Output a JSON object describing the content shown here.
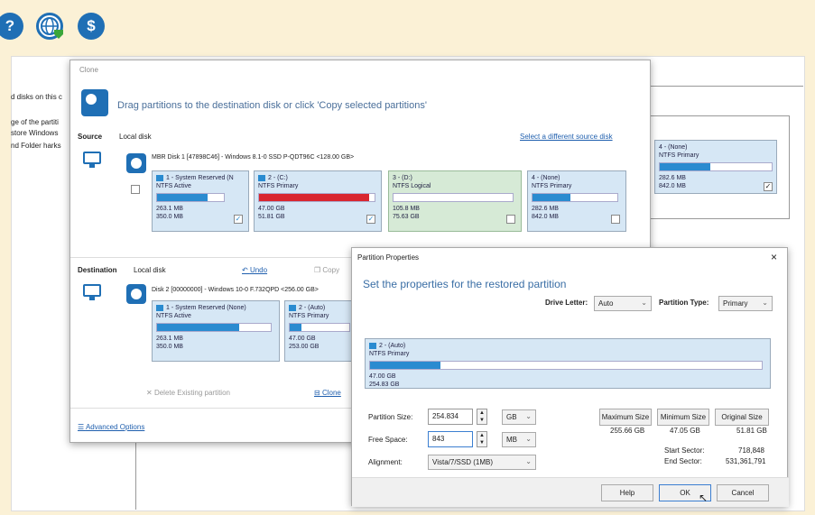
{
  "toolbar": {
    "icon1": "?",
    "icon3": "$"
  },
  "bg": {
    "line1": "d disks on this c",
    "line2": "ge of the partiti",
    "line3": "store Windows",
    "line4": "nd Folder harks",
    "panel_part": {
      "title": "4 - (None)",
      "type": "NTFS Primary",
      "size1": "282.6 MB",
      "size2": "842.0 MB",
      "bar": 0.45
    }
  },
  "clone": {
    "title": "Clone",
    "header": "Drag partitions to the destination disk or click 'Copy selected partitions'",
    "source_label": "Source",
    "source_type": "Local disk",
    "select_source_link": "Select a different source disk",
    "source_disk_info": "MBR Disk 1 [47898C46] - Windows 8.1-0 SSD P-QDT96C <128.00 GB>",
    "source_partitions": [
      {
        "title": "1 - System Reserved (N",
        "type": "NTFS Active",
        "s1": "263.1 MB",
        "s2": "350.0 MB",
        "fill": 0.75,
        "color": "blue",
        "checked": true
      },
      {
        "title": "2 - (C:)",
        "type": "NTFS Primary",
        "s1": "47.00 GB",
        "s2": "51.81 GB",
        "fill": 0.95,
        "color": "red",
        "checked": true
      },
      {
        "title": "3 - (D:)",
        "type": "NTFS Logical",
        "s1": "105.8 MB",
        "s2": "75.63 GB",
        "fill": 0.0,
        "color": "blue",
        "checked": false
      },
      {
        "title": "4 - (None)",
        "type": "NTFS Primary",
        "s1": "282.6 MB",
        "s2": "842.0 MB",
        "fill": 0.45,
        "color": "blue",
        "checked": false
      }
    ],
    "dest_label": "Destination",
    "dest_type": "Local disk",
    "undo": "Undo",
    "copy": "Copy",
    "dest_disk_info": "Disk 2 [00000000] - Windows 10-0 F.732QPD <256.00 GB>",
    "dest_partitions": [
      {
        "title": "1 - System Reserved (None)",
        "type": "NTFS Active",
        "s1": "263.1 MB",
        "s2": "350.0 MB",
        "fill": 0.72
      },
      {
        "title": "2 - (Auto)",
        "type": "NTFS Primary",
        "s1": "47.00 GB",
        "s2": "253.00 GB",
        "fill": 0.2
      }
    ],
    "delete_existing": "Delete Existing partition",
    "clone_link": "Clone",
    "advanced_options": "Advanced Options"
  },
  "props": {
    "title": "Partition Properties",
    "close": "×",
    "heading": "Set the properties for the restored partition",
    "drive_letter_label": "Drive Letter:",
    "drive_letter_value": "Auto",
    "partition_type_label": "Partition Type:",
    "partition_type_value": "Primary",
    "part_title": "2 - (Auto)",
    "part_type": "NTFS Primary",
    "part_s1": "47.00 GB",
    "part_s2": "254.83 GB",
    "part_fill": 0.18,
    "size_label": "Partition Size:",
    "size_value": "254.834",
    "size_unit": "GB",
    "free_label": "Free Space:",
    "free_value": "843",
    "free_unit": "MB",
    "align_label": "Alignment:",
    "align_value": "Vista/7/SSD (1MB)",
    "max_btn": "Maximum Size",
    "max_val": "255.66 GB",
    "min_btn": "Minimum Size",
    "min_val": "47.05 GB",
    "orig_btn": "Original Size",
    "orig_val": "51.81 GB",
    "start_label": "Start Sector:",
    "start_val": "718,848",
    "end_label": "End Sector:",
    "end_val": "531,361,791",
    "help": "Help",
    "ok": "OK",
    "cancel": "Cancel"
  }
}
